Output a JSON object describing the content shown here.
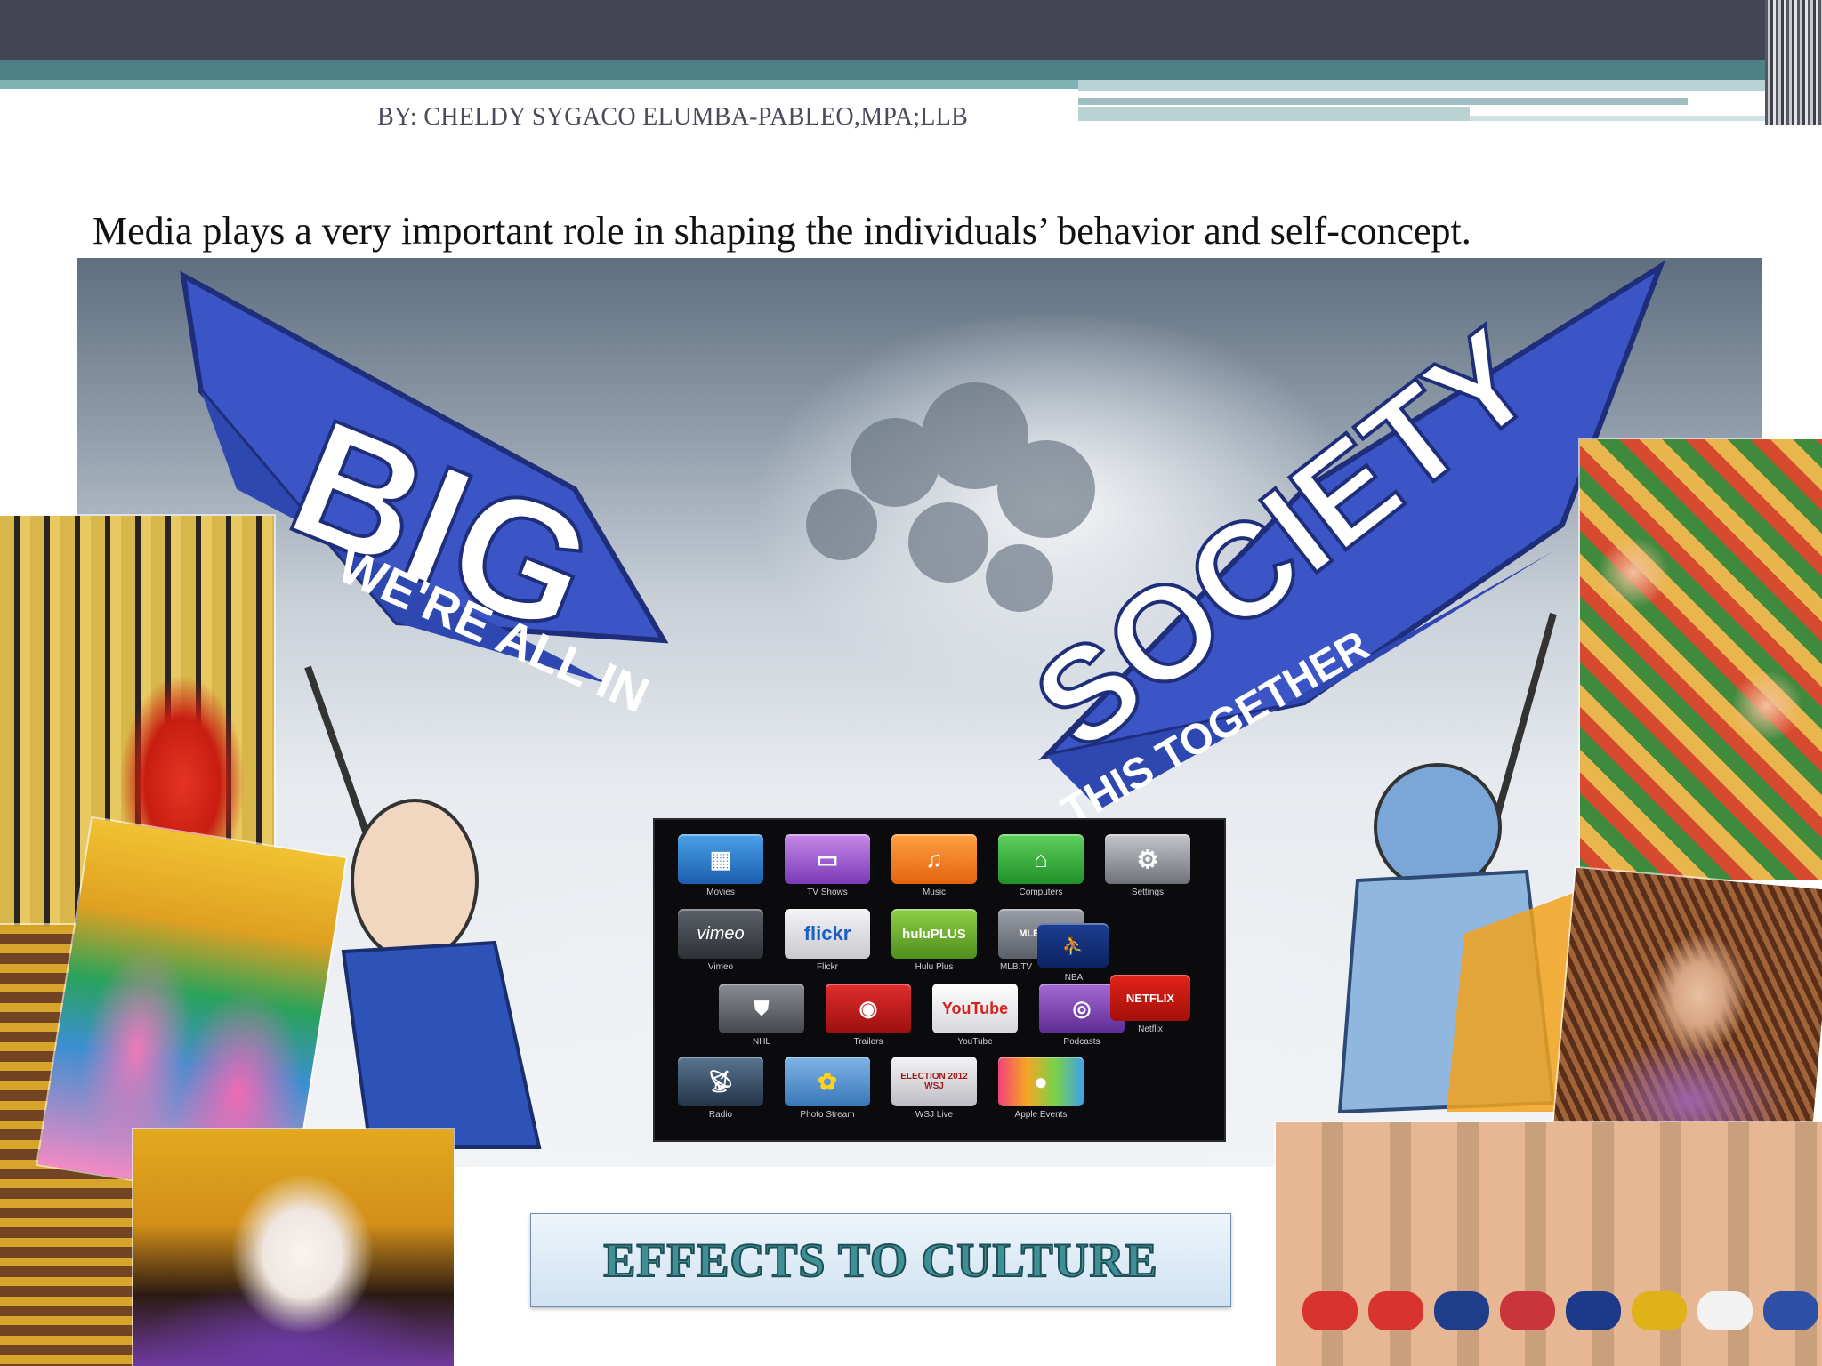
{
  "slide": {
    "byline": "BY: CHELDY SYGACO ELUMBA-PABLEO,MPA;LLB",
    "headline": "Media plays a very important role  in shaping the individuals’ behavior and self-concept.",
    "cartoon": {
      "banner_left_big": "BIG",
      "banner_left_small": "WE'RE ALL IN",
      "banner_right_big": "SOCIETY",
      "banner_right_small": "THIS TOGETHER"
    },
    "tv_menu": {
      "row1": [
        "Movies",
        "TV Shows",
        "Music",
        "Computers",
        "Settings"
      ],
      "row2": [
        "Vimeo",
        "Flickr",
        "Hulu Plus",
        "MLB.TV",
        "NBA"
      ],
      "row3": [
        "NHL",
        "Trailers",
        "YouTube",
        "Podcasts",
        "Netflix"
      ],
      "row4": [
        "Radio",
        "Photo Stream",
        "WSJ Live",
        "Apple Events"
      ],
      "tile_texts": {
        "vimeo": "vimeo",
        "flickr": "flickr",
        "hulu": "huluPLUS",
        "mlb": "MLB.com",
        "youtube": "YouTube",
        "netflix": "NETFLIX",
        "wsj": "ELECTION 2012 WSJ"
      }
    },
    "title_box": "EFFECTS TO CULTURE"
  },
  "colors": {
    "top_bar": "#444553",
    "teal": "#4d8186",
    "title_text": "#3f8f96",
    "banner_blue": "#3b55c6"
  }
}
